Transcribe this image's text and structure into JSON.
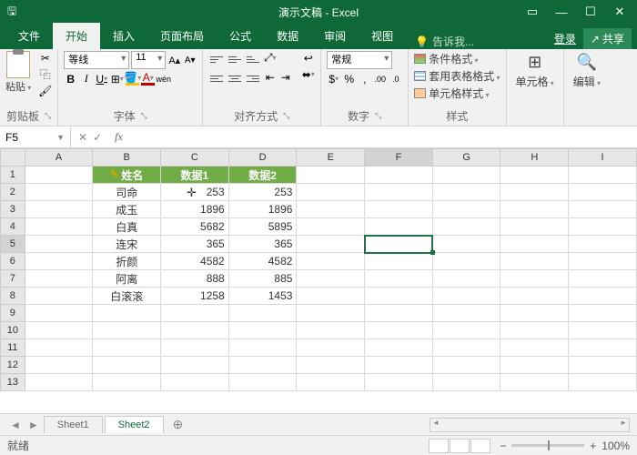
{
  "title": "演示文稿 - Excel",
  "tabs": {
    "file": "文件",
    "home": "开始",
    "insert": "插入",
    "layout": "页面布局",
    "formulas": "公式",
    "data": "数据",
    "review": "审阅",
    "view": "视图"
  },
  "tellme": "告诉我...",
  "login": "登录",
  "share": "共享",
  "ribbon": {
    "paste": "粘贴",
    "clipboard": "剪贴板",
    "fontname": "等线",
    "fontsize": "11",
    "fontgrp": "字体",
    "aligngrp": "对齐方式",
    "numformat": "常规",
    "numgrp": "数字",
    "condfmt": "条件格式",
    "tablefmt": "套用表格格式",
    "cellstyle": "单元格样式",
    "stylegrp": "样式",
    "cellsgrp": "单元格",
    "editgrp": "编辑"
  },
  "namebox": "F5",
  "cols": [
    "A",
    "B",
    "C",
    "D",
    "E",
    "F",
    "G",
    "H",
    "I"
  ],
  "headers": {
    "b": "姓名",
    "c": "数据1",
    "d": "数据2"
  },
  "rows": [
    {
      "b": "司命",
      "c": "253",
      "d": "253"
    },
    {
      "b": "成玉",
      "c": "1896",
      "d": "1896"
    },
    {
      "b": "白真",
      "c": "5682",
      "d": "5895"
    },
    {
      "b": "连宋",
      "c": "365",
      "d": "365"
    },
    {
      "b": "折颜",
      "c": "4582",
      "d": "4582"
    },
    {
      "b": "阿离",
      "c": "888",
      "d": "885"
    },
    {
      "b": "白滚滚",
      "c": "1258",
      "d": "1453"
    }
  ],
  "sheets": {
    "s1": "Sheet1",
    "s2": "Sheet2"
  },
  "status": "就绪",
  "zoom": "100%",
  "chart_data": {
    "type": "table",
    "columns": [
      "姓名",
      "数据1",
      "数据2"
    ],
    "data": [
      [
        "司命",
        253,
        253
      ],
      [
        "成玉",
        1896,
        1896
      ],
      [
        "白真",
        5682,
        5895
      ],
      [
        "连宋",
        365,
        365
      ],
      [
        "折颜",
        4582,
        4582
      ],
      [
        "阿离",
        888,
        885
      ],
      [
        "白滚滚",
        1258,
        1453
      ]
    ]
  }
}
